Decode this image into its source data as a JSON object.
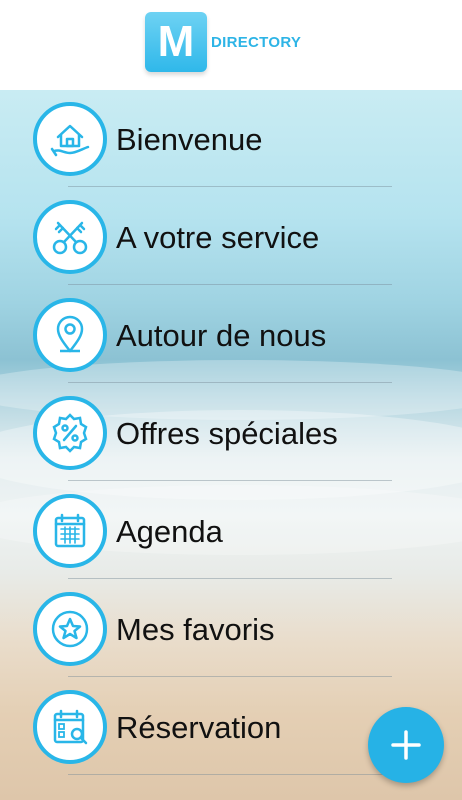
{
  "header": {
    "logo_letter": "M",
    "logo_text": "DIRECTORY"
  },
  "menu": {
    "items": [
      {
        "label": "Bienvenue",
        "icon": "house-hand-icon"
      },
      {
        "label": "A votre service",
        "icon": "keys-icon"
      },
      {
        "label": "Autour de nous",
        "icon": "map-pin-icon"
      },
      {
        "label": "Offres spéciales",
        "icon": "percent-badge-icon"
      },
      {
        "label": "Agenda",
        "icon": "calendar-icon"
      },
      {
        "label": "Mes favoris",
        "icon": "star-icon"
      },
      {
        "label": "Réservation",
        "icon": "reservation-calendar-icon"
      }
    ]
  },
  "fab": {
    "icon": "plus-icon"
  },
  "colors": {
    "accent": "#29b6e8",
    "text": "#111111"
  }
}
